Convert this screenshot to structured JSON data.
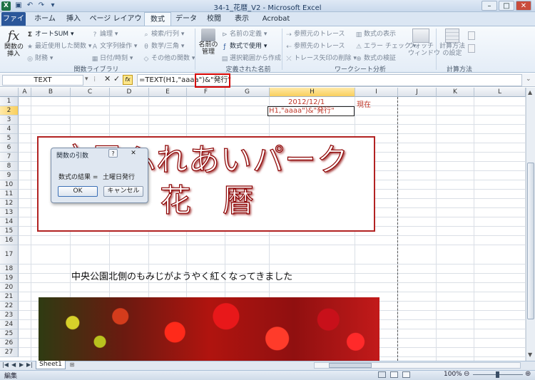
{
  "window": {
    "title": "34-1_花暦_V2 - Microsoft Excel",
    "icons": [
      "excel-logo",
      "save-icon",
      "undo-icon",
      "redo-icon",
      "customize-qat-icon"
    ]
  },
  "tabs": [
    {
      "label": "ファイル"
    },
    {
      "label": "ホーム"
    },
    {
      "label": "挿入"
    },
    {
      "label": "ページ レイアウト"
    },
    {
      "label": "数式"
    },
    {
      "label": "データ"
    },
    {
      "label": "校閲"
    },
    {
      "label": "表示"
    },
    {
      "label": "Acrobat"
    }
  ],
  "ribbon": {
    "function_library": {
      "insert_function": "関数の\n挿入",
      "autosum": "オートSUM",
      "recent": "最近使用した関数",
      "financial": "財務",
      "logical": "論理",
      "text": "文字列操作",
      "datetime": "日付/時刻",
      "lookup": "検索/行列",
      "math": "数学/三角",
      "more": "その他の関数",
      "group_label": "関数ライブラリ"
    },
    "defined_names": {
      "name_manager": "名前の\n管理",
      "define_name": "名前の定義",
      "use_in_formula": "数式で使用",
      "create_from_selection": "選択範囲から作成",
      "group_label": "定義された名前"
    },
    "formula_auditing": {
      "trace_precedents": "参照元のトレース",
      "trace_dependents": "参照先のトレース",
      "remove_arrows": "トレース矢印の削除",
      "show_formulas": "数式の表示",
      "error_checking": "エラー チェック",
      "evaluate_formula": "数式の検証",
      "watch_window": "ウォッチ\nウィンドウ",
      "group_label": "ワークシート分析"
    },
    "calculation": {
      "calc_options": "計算方法\nの設定",
      "group_label": "計算方法"
    }
  },
  "formula_bar": {
    "name_box": "TEXT",
    "cancel_glyph": "✕",
    "enter_glyph": "✓",
    "fx_glyph": "fx",
    "formula": "=TEXT(H1,\"aaaa\")&\"発行\""
  },
  "columns": [
    "A",
    "B",
    "C",
    "D",
    "E",
    "F",
    "G",
    "H",
    "I",
    "J",
    "K",
    "L"
  ],
  "rows": [
    "1",
    "2",
    "3",
    "4",
    "5",
    "6",
    "7",
    "8",
    "9",
    "10",
    "11",
    "12",
    "13",
    "14",
    "15",
    "16",
    "17",
    "18",
    "19",
    "20",
    "21",
    "22",
    "23",
    "24",
    "25",
    "26",
    "27"
  ],
  "cells": {
    "h1": "2012/12/1",
    "i1": "現在",
    "h2": "H1,\"aaaa\")&\"発行\""
  },
  "banner": {
    "line1": "市民ふれあいパーク",
    "line2": "花　暦"
  },
  "caption": "中央公園北側のもみじがようやく紅くなってきました",
  "dialog": {
    "title": "関数の引数",
    "help_glyph": "?",
    "close_glyph": "✕",
    "result_label": "数式の結果 =",
    "result_value": "土曜日発行",
    "ok": "OK",
    "cancel": "キャンセル"
  },
  "sheet_tabs": {
    "sheet1": "Sheet1"
  },
  "status": {
    "mode": "編集",
    "zoom": "100%"
  },
  "colors": {
    "file_tab": "#2b579a",
    "accent_red": "#d40000",
    "selection_header": "#f9cf5c"
  }
}
